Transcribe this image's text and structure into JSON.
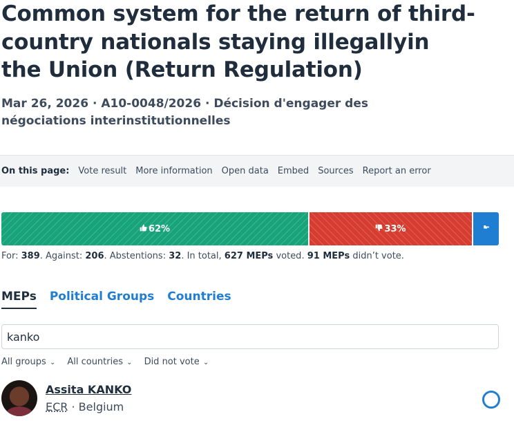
{
  "title": {
    "line1": "Common system for the return of third-",
    "line2": "country nationals staying illegallyin",
    "line3": "the Union (Return Regulation)"
  },
  "meta": "Mar 26, 2026 · A10-0048/2026 · Décision d'engager des négociations interinstitutionnelles",
  "on_this_page": {
    "label": "On this page:",
    "links": [
      "Vote result",
      "More information",
      "Open data",
      "Embed",
      "Sources",
      "Report an error"
    ]
  },
  "result_bar": {
    "for_pct": "62%",
    "against_pct": "33%",
    "colors": {
      "for": "#18a47a",
      "against": "#d63c2f",
      "abstention": "#1f7ed1"
    },
    "icons": {
      "for": "thumbs-up-icon",
      "against": "thumbs-down-icon",
      "abstention": "hand-icon"
    }
  },
  "summary": {
    "for_label": "For: ",
    "for": "389",
    "against_label": ". Against: ",
    "against": "206",
    "abst_label": ". Abstentions: ",
    "abst": "32",
    "total_label": ". In total, ",
    "total": "627 MEPs",
    "voted_label": " voted. ",
    "didnt": "91 MEPs",
    "didnt_label": " didn’t vote."
  },
  "tabs": [
    "MEPs",
    "Political Groups",
    "Countries"
  ],
  "search": {
    "value": "kanko"
  },
  "filters": [
    "All groups",
    "All countries",
    "Did not vote"
  ],
  "mep": {
    "name": "Assita KANKO",
    "group": "ECR",
    "separator": " · ",
    "country": "Belgium"
  }
}
